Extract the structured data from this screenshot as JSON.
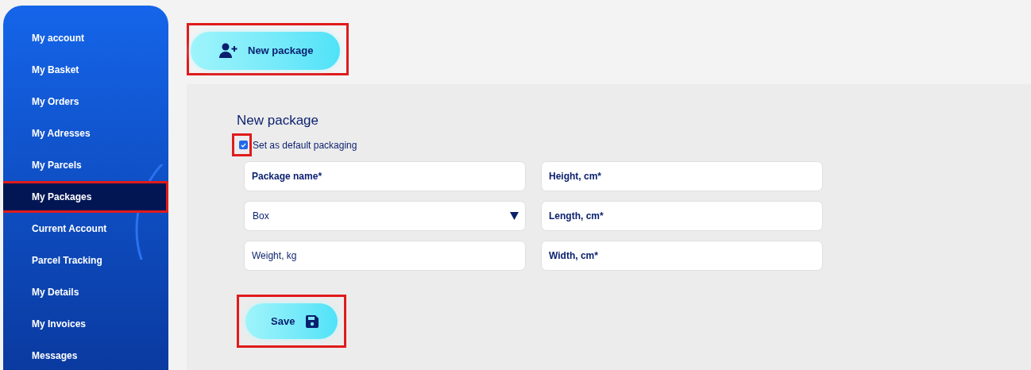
{
  "sidebar": {
    "items": [
      {
        "label": "My account",
        "selected": false,
        "highlighted": false
      },
      {
        "label": "My Basket",
        "selected": false,
        "highlighted": false
      },
      {
        "label": "My Orders",
        "selected": false,
        "highlighted": false
      },
      {
        "label": "My Adresses",
        "selected": false,
        "highlighted": false
      },
      {
        "label": "My Parcels",
        "selected": false,
        "highlighted": false
      },
      {
        "label": "My Packages",
        "selected": true,
        "highlighted": true
      },
      {
        "label": "Current Account",
        "selected": false,
        "highlighted": false
      },
      {
        "label": "Parcel Tracking",
        "selected": false,
        "highlighted": false
      },
      {
        "label": "My Details",
        "selected": false,
        "highlighted": false
      },
      {
        "label": "My Invoices",
        "selected": false,
        "highlighted": false
      },
      {
        "label": "Messages",
        "selected": false,
        "highlighted": false
      }
    ]
  },
  "new_package_button": {
    "label": "New package",
    "highlighted": true
  },
  "form": {
    "title": "New package",
    "default_checkbox": {
      "label": "Set as default packaging",
      "checked": true,
      "highlighted": true
    },
    "fields": [
      {
        "kind": "input",
        "placeholder": "Package name*",
        "required": true
      },
      {
        "kind": "input",
        "placeholder": "Height, cm*",
        "required": true
      },
      {
        "kind": "select",
        "value": "Box"
      },
      {
        "kind": "input",
        "placeholder": "Length, cm*",
        "required": true
      },
      {
        "kind": "input",
        "placeholder": "Weight, kg",
        "required": false
      },
      {
        "kind": "input",
        "placeholder": "Width, cm*",
        "required": true
      }
    ],
    "save_button": {
      "label": "Save",
      "highlighted": true
    }
  }
}
